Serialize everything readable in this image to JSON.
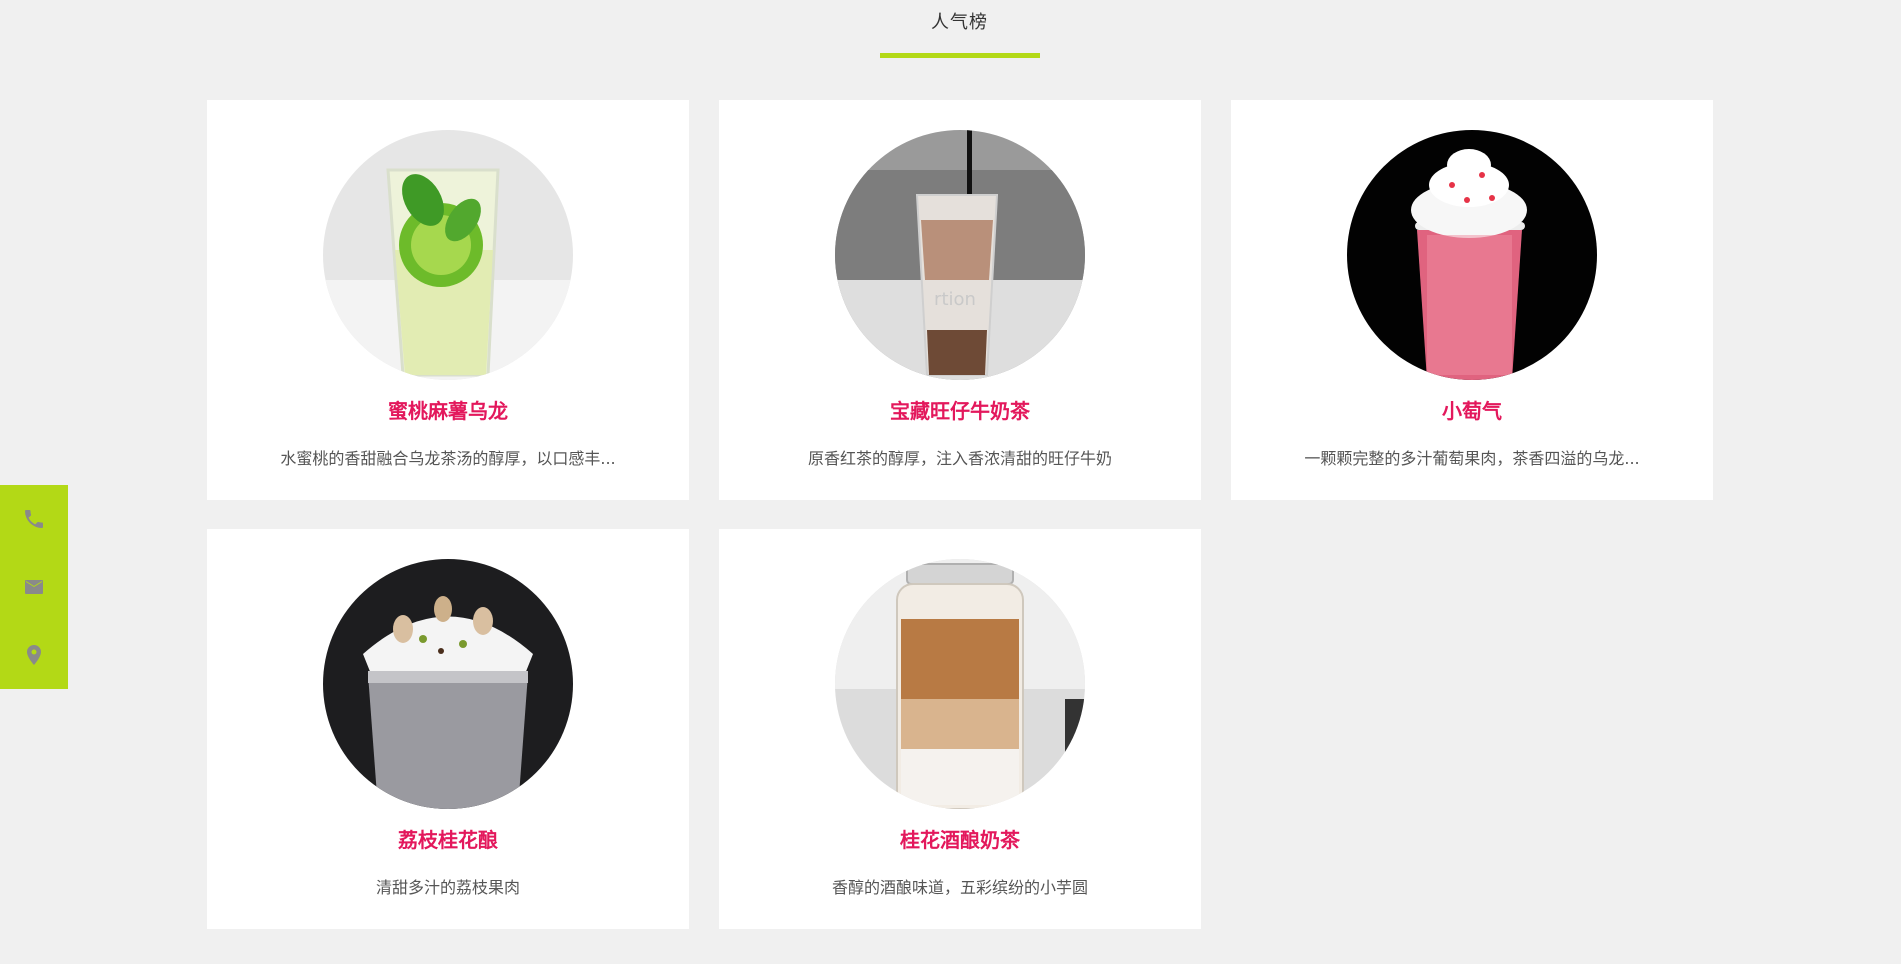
{
  "section": {
    "title": "人气榜",
    "accent": "#b3d916"
  },
  "products": [
    {
      "name": "蜜桃麻薯乌龙",
      "desc": "水蜜桃的香甜融合乌龙茶汤的醇厚，以口感丰..."
    },
    {
      "name": "宝藏旺仔牛奶茶",
      "desc": "原香红茶的醇厚，注入香浓清甜的旺仔牛奶"
    },
    {
      "name": "小萄气",
      "desc": "一颗颗完整的多汁葡萄果肉，茶香四溢的乌龙..."
    },
    {
      "name": "荔枝桂花酿",
      "desc": "清甜多汁的荔枝果肉"
    },
    {
      "name": "桂花酒酿奶茶",
      "desc": "香醇的酒酿味道，五彩缤纷的小芋圆"
    }
  ],
  "side_contacts": [
    {
      "icon": "phone-icon"
    },
    {
      "icon": "mail-icon"
    },
    {
      "icon": "location-pin-icon"
    }
  ],
  "colors": {
    "background": "#f0f0f0",
    "name": "#e3185c",
    "accent": "#b3d916"
  }
}
